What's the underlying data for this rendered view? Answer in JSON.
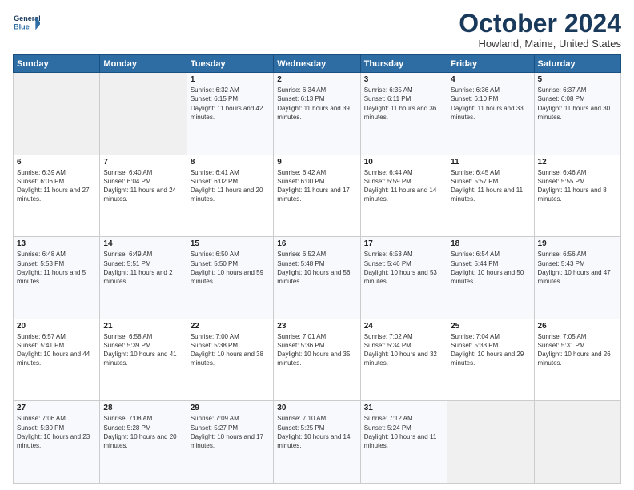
{
  "header": {
    "logo_line1": "General",
    "logo_line2": "Blue",
    "title": "October 2024",
    "subtitle": "Howland, Maine, United States"
  },
  "weekdays": [
    "Sunday",
    "Monday",
    "Tuesday",
    "Wednesday",
    "Thursday",
    "Friday",
    "Saturday"
  ],
  "weeks": [
    [
      {
        "day": "",
        "info": ""
      },
      {
        "day": "",
        "info": ""
      },
      {
        "day": "1",
        "info": "Sunrise: 6:32 AM\nSunset: 6:15 PM\nDaylight: 11 hours and 42 minutes."
      },
      {
        "day": "2",
        "info": "Sunrise: 6:34 AM\nSunset: 6:13 PM\nDaylight: 11 hours and 39 minutes."
      },
      {
        "day": "3",
        "info": "Sunrise: 6:35 AM\nSunset: 6:11 PM\nDaylight: 11 hours and 36 minutes."
      },
      {
        "day": "4",
        "info": "Sunrise: 6:36 AM\nSunset: 6:10 PM\nDaylight: 11 hours and 33 minutes."
      },
      {
        "day": "5",
        "info": "Sunrise: 6:37 AM\nSunset: 6:08 PM\nDaylight: 11 hours and 30 minutes."
      }
    ],
    [
      {
        "day": "6",
        "info": "Sunrise: 6:39 AM\nSunset: 6:06 PM\nDaylight: 11 hours and 27 minutes."
      },
      {
        "day": "7",
        "info": "Sunrise: 6:40 AM\nSunset: 6:04 PM\nDaylight: 11 hours and 24 minutes."
      },
      {
        "day": "8",
        "info": "Sunrise: 6:41 AM\nSunset: 6:02 PM\nDaylight: 11 hours and 20 minutes."
      },
      {
        "day": "9",
        "info": "Sunrise: 6:42 AM\nSunset: 6:00 PM\nDaylight: 11 hours and 17 minutes."
      },
      {
        "day": "10",
        "info": "Sunrise: 6:44 AM\nSunset: 5:59 PM\nDaylight: 11 hours and 14 minutes."
      },
      {
        "day": "11",
        "info": "Sunrise: 6:45 AM\nSunset: 5:57 PM\nDaylight: 11 hours and 11 minutes."
      },
      {
        "day": "12",
        "info": "Sunrise: 6:46 AM\nSunset: 5:55 PM\nDaylight: 11 hours and 8 minutes."
      }
    ],
    [
      {
        "day": "13",
        "info": "Sunrise: 6:48 AM\nSunset: 5:53 PM\nDaylight: 11 hours and 5 minutes."
      },
      {
        "day": "14",
        "info": "Sunrise: 6:49 AM\nSunset: 5:51 PM\nDaylight: 11 hours and 2 minutes."
      },
      {
        "day": "15",
        "info": "Sunrise: 6:50 AM\nSunset: 5:50 PM\nDaylight: 10 hours and 59 minutes."
      },
      {
        "day": "16",
        "info": "Sunrise: 6:52 AM\nSunset: 5:48 PM\nDaylight: 10 hours and 56 minutes."
      },
      {
        "day": "17",
        "info": "Sunrise: 6:53 AM\nSunset: 5:46 PM\nDaylight: 10 hours and 53 minutes."
      },
      {
        "day": "18",
        "info": "Sunrise: 6:54 AM\nSunset: 5:44 PM\nDaylight: 10 hours and 50 minutes."
      },
      {
        "day": "19",
        "info": "Sunrise: 6:56 AM\nSunset: 5:43 PM\nDaylight: 10 hours and 47 minutes."
      }
    ],
    [
      {
        "day": "20",
        "info": "Sunrise: 6:57 AM\nSunset: 5:41 PM\nDaylight: 10 hours and 44 minutes."
      },
      {
        "day": "21",
        "info": "Sunrise: 6:58 AM\nSunset: 5:39 PM\nDaylight: 10 hours and 41 minutes."
      },
      {
        "day": "22",
        "info": "Sunrise: 7:00 AM\nSunset: 5:38 PM\nDaylight: 10 hours and 38 minutes."
      },
      {
        "day": "23",
        "info": "Sunrise: 7:01 AM\nSunset: 5:36 PM\nDaylight: 10 hours and 35 minutes."
      },
      {
        "day": "24",
        "info": "Sunrise: 7:02 AM\nSunset: 5:34 PM\nDaylight: 10 hours and 32 minutes."
      },
      {
        "day": "25",
        "info": "Sunrise: 7:04 AM\nSunset: 5:33 PM\nDaylight: 10 hours and 29 minutes."
      },
      {
        "day": "26",
        "info": "Sunrise: 7:05 AM\nSunset: 5:31 PM\nDaylight: 10 hours and 26 minutes."
      }
    ],
    [
      {
        "day": "27",
        "info": "Sunrise: 7:06 AM\nSunset: 5:30 PM\nDaylight: 10 hours and 23 minutes."
      },
      {
        "day": "28",
        "info": "Sunrise: 7:08 AM\nSunset: 5:28 PM\nDaylight: 10 hours and 20 minutes."
      },
      {
        "day": "29",
        "info": "Sunrise: 7:09 AM\nSunset: 5:27 PM\nDaylight: 10 hours and 17 minutes."
      },
      {
        "day": "30",
        "info": "Sunrise: 7:10 AM\nSunset: 5:25 PM\nDaylight: 10 hours and 14 minutes."
      },
      {
        "day": "31",
        "info": "Sunrise: 7:12 AM\nSunset: 5:24 PM\nDaylight: 10 hours and 11 minutes."
      },
      {
        "day": "",
        "info": ""
      },
      {
        "day": "",
        "info": ""
      }
    ]
  ]
}
